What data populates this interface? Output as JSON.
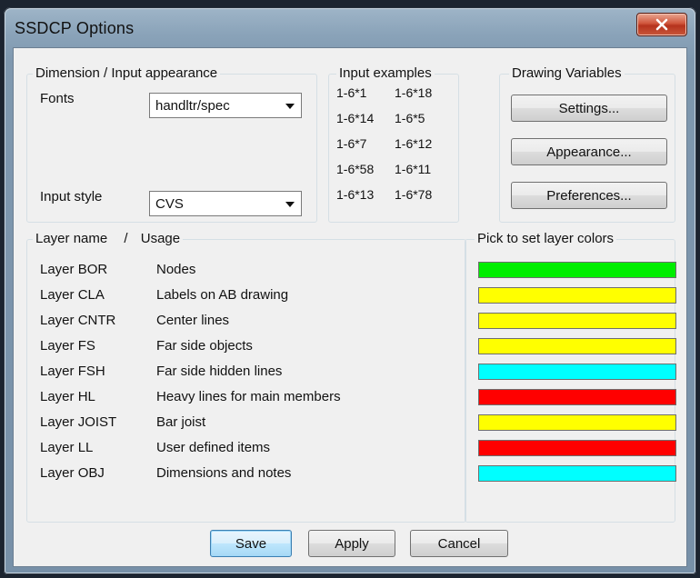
{
  "window": {
    "title": "SSDCP Options"
  },
  "close_icon": "close-icon",
  "dimension_group": {
    "label": "Dimension / Input appearance",
    "fonts_label": "Fonts",
    "fonts_value": "handltr/spec",
    "input_style_label": "Input style",
    "input_style_value": "CVS"
  },
  "examples_group": {
    "label": "Input examples",
    "col1": [
      "1-6*1",
      "1-6*14",
      "1-6*7",
      "1-6*58",
      "1-6*13"
    ],
    "col2": [
      "1-6*18",
      "1-6*5",
      "1-6*12",
      "1-6*11",
      "1-6*78"
    ]
  },
  "drawing_group": {
    "label": "Drawing Variables",
    "settings": "Settings...",
    "appearance": "Appearance...",
    "preferences": "Preferences..."
  },
  "layer_group": {
    "header_name": "Layer name",
    "header_sep": "/",
    "header_usage": "Usage",
    "layers": [
      {
        "name": "Layer BOR",
        "usage": "Nodes",
        "color": "#00ee00"
      },
      {
        "name": "Layer CLA",
        "usage": "Labels on AB drawing",
        "color": "#ffff00"
      },
      {
        "name": "Layer CNTR",
        "usage": "Center lines",
        "color": "#ffff00"
      },
      {
        "name": "Layer FS",
        "usage": "Far side objects",
        "color": "#ffff00"
      },
      {
        "name": "Layer FSH",
        "usage": "Far side hidden lines",
        "color": "#00ffff"
      },
      {
        "name": "Layer HL",
        "usage": "Heavy lines for main members",
        "color": "#ff0000"
      },
      {
        "name": "Layer JOIST",
        "usage": "Bar joist",
        "color": "#ffff00"
      },
      {
        "name": "Layer LL",
        "usage": "User defined items",
        "color": "#ff0000"
      },
      {
        "name": "Layer OBJ",
        "usage": "Dimensions and notes",
        "color": "#00ffff"
      }
    ]
  },
  "colors_group": {
    "label": "Pick to set layer colors"
  },
  "footer": {
    "save": "Save",
    "apply": "Apply",
    "cancel": "Cancel"
  }
}
